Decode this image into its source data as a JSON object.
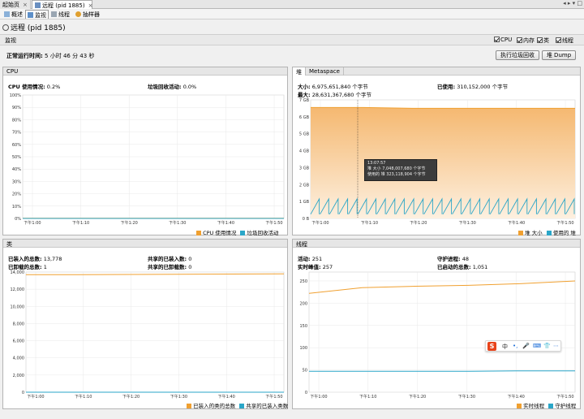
{
  "window": {
    "tabs": [
      {
        "label": "起始页",
        "close": "×"
      },
      {
        "label": "远程 (pid 1885)",
        "close": "×"
      }
    ],
    "controls": "◂ ▸ ▾ □"
  },
  "subtabs": [
    {
      "label": "概述"
    },
    {
      "label": "监视"
    },
    {
      "label": "线程"
    },
    {
      "label": "抽样器"
    }
  ],
  "process_title": "远程 (pid 1885)",
  "monitor": {
    "section_label": "监视",
    "checkboxes": [
      {
        "label": "CPU"
      },
      {
        "label": "内存"
      },
      {
        "label": "类"
      },
      {
        "label": "线程"
      }
    ],
    "uptime_label": "正常运行时间:",
    "uptime_value": "5 小时 46 分 43 秒",
    "gc_button": "执行垃圾回收",
    "dump_button": "堆 Dump"
  },
  "x_ticks": [
    "下午1:00",
    "下午1:10",
    "下午1:20",
    "下午1:30",
    "下午1:40",
    "下午1:50"
  ],
  "cpu": {
    "title": "CPU",
    "usage_label": "CPU 使用情况:",
    "usage_value": "0.2%",
    "gc_label": "垃圾回收活动:",
    "gc_value": "0.0%",
    "legend": [
      "CPU 使用情况",
      "垃圾回收活动"
    ],
    "colors": [
      "#f0a030",
      "#2aa6c8"
    ]
  },
  "heap": {
    "tabs": [
      "堆",
      "Metaspace"
    ],
    "size_label": "大小:",
    "size_value": "6,975,651,840 个字节",
    "max_label": "最大:",
    "max_value": "28,631,367,680 个字节",
    "used_label": "已使用:",
    "used_value": "310,152,000 个字节",
    "legend": [
      "堆 大小",
      "使用的 堆"
    ],
    "tooltip": {
      "time": "13:07:57",
      "size_label": "堆 大小",
      "size_value": "7,048,007,680 个字节",
      "used_label": "使用的 堆",
      "used_value": "323,118,904 个字节"
    },
    "colors": [
      "#f0a030",
      "#2aa6c8"
    ]
  },
  "classes": {
    "title": "类",
    "loaded_label": "已装入的总数:",
    "loaded_value": "13,778",
    "unloaded_label": "已卸载的总数:",
    "unloaded_value": "1",
    "shared_loaded_label": "共享的已装入数:",
    "shared_loaded_value": "0",
    "shared_unloaded_label": "共享的已卸载数:",
    "shared_unloaded_value": "0",
    "legend": [
      "已装入的类的总数",
      "共享的已装入类数"
    ],
    "colors": [
      "#f0a030",
      "#2aa6c8"
    ]
  },
  "threads": {
    "title": "线程",
    "live_label": "活动:",
    "live_value": "251",
    "peak_label": "实时峰值:",
    "peak_value": "257",
    "daemon_label": "守护进程:",
    "daemon_value": "48",
    "started_label": "已启动的总数:",
    "started_value": "1,051",
    "legend": [
      "实时线程",
      "守护线程"
    ],
    "colors": [
      "#f0a030",
      "#2aa6c8"
    ]
  },
  "ime": {
    "logo": "S",
    "items": [
      "中",
      "•,",
      "🎤",
      "⌨",
      "👕",
      "⋯"
    ]
  },
  "chart_data": [
    {
      "type": "line",
      "title": "CPU",
      "x": [
        "下午1:00",
        "下午1:10",
        "下午1:20",
        "下午1:30",
        "下午1:40",
        "下午1:50"
      ],
      "y_ticks": [
        "0%",
        "10%",
        "20%",
        "30%",
        "40%",
        "50%",
        "60%",
        "70%",
        "80%",
        "90%",
        "100%"
      ],
      "ylim": [
        0,
        100
      ],
      "series": [
        {
          "name": "CPU 使用情况",
          "values": [
            0.2,
            0.2,
            0.2,
            0.2,
            0.2,
            0.2
          ]
        },
        {
          "name": "垃圾回收活动",
          "values": [
            0,
            0,
            0,
            0,
            0,
            0
          ]
        }
      ]
    },
    {
      "type": "area",
      "title": "堆",
      "y_ticks": [
        "0 B",
        "1 GB",
        "2 GB",
        "3 GB",
        "4 GB",
        "5 GB",
        "6 GB",
        "7 GB"
      ],
      "ylim": [
        0,
        7
      ],
      "unit": "GB",
      "series": [
        {
          "name": "堆 大小",
          "values": [
            6.55,
            6.55,
            6.5,
            6.5,
            6.5,
            6.5
          ]
        },
        {
          "name": "使用的 堆",
          "values": [
            0.3,
            0.3,
            0.3,
            0.3,
            0.3,
            0.3
          ]
        }
      ]
    },
    {
      "type": "line",
      "title": "类",
      "y_ticks": [
        "0",
        "2,000",
        "4,000",
        "6,000",
        "8,000",
        "10,000",
        "12,000",
        "14,000"
      ],
      "ylim": [
        0,
        14000
      ],
      "series": [
        {
          "name": "已装入的类的总数",
          "values": [
            13700,
            13700,
            13720,
            13740,
            13760,
            13778
          ]
        },
        {
          "name": "共享的已装入类数",
          "values": [
            0,
            0,
            0,
            0,
            0,
            0
          ]
        }
      ]
    },
    {
      "type": "line",
      "title": "线程",
      "y_ticks": [
        "0",
        "50",
        "100",
        "150",
        "200",
        "250"
      ],
      "ylim": [
        0,
        270
      ],
      "series": [
        {
          "name": "实时线程",
          "values": [
            222,
            235,
            238,
            240,
            244,
            250
          ]
        },
        {
          "name": "守护线程",
          "values": [
            47,
            47,
            47,
            47,
            48,
            48
          ]
        }
      ]
    }
  ]
}
